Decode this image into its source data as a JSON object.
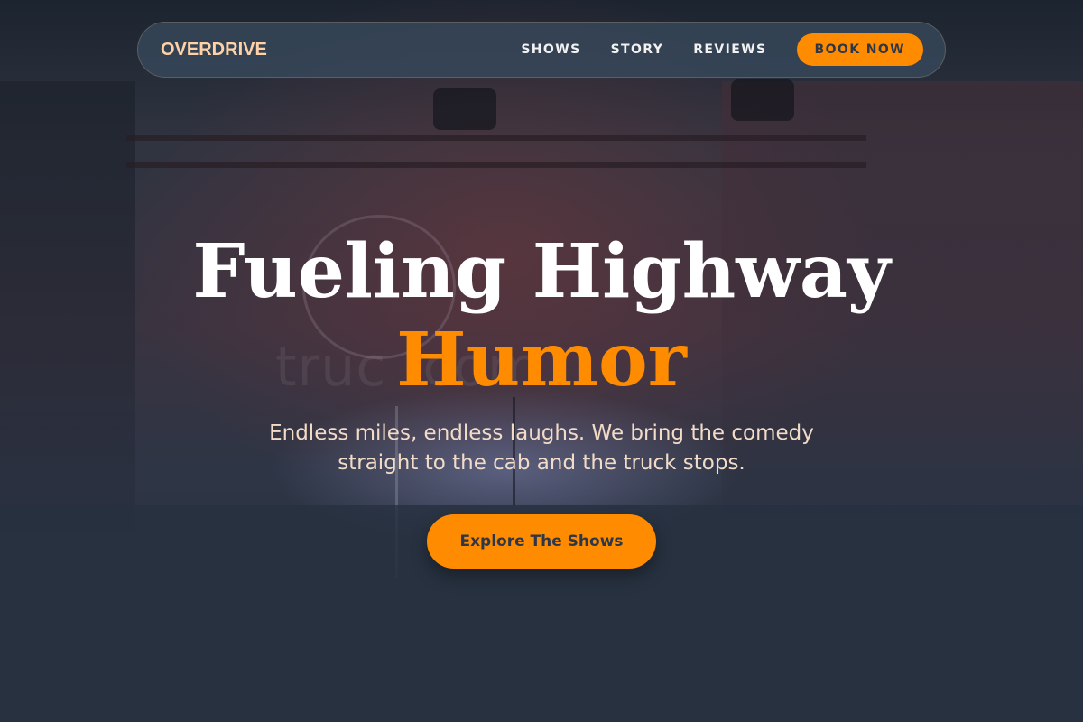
{
  "brand": {
    "name": "OVERDRIVE"
  },
  "nav": {
    "links": [
      "SHOWS",
      "STORY",
      "REVIEWS"
    ],
    "cta_label": "BOOK NOW"
  },
  "hero": {
    "title_line1": "Fueling Highway",
    "title_line2": "Humor",
    "subtitle": "Endless miles, endless laughs. We bring the comedy straight to the cab and the truck stops.",
    "cta_label": "Explore The Shows",
    "background_watermark": "truc                  .com"
  },
  "colors": {
    "accent": "#ff8c00",
    "navbar_bg": "#37485a",
    "logo": "#ffd1a6",
    "subtitle": "#f2dcc8",
    "button_text": "#2d3748",
    "page_bg": "#27313f"
  }
}
